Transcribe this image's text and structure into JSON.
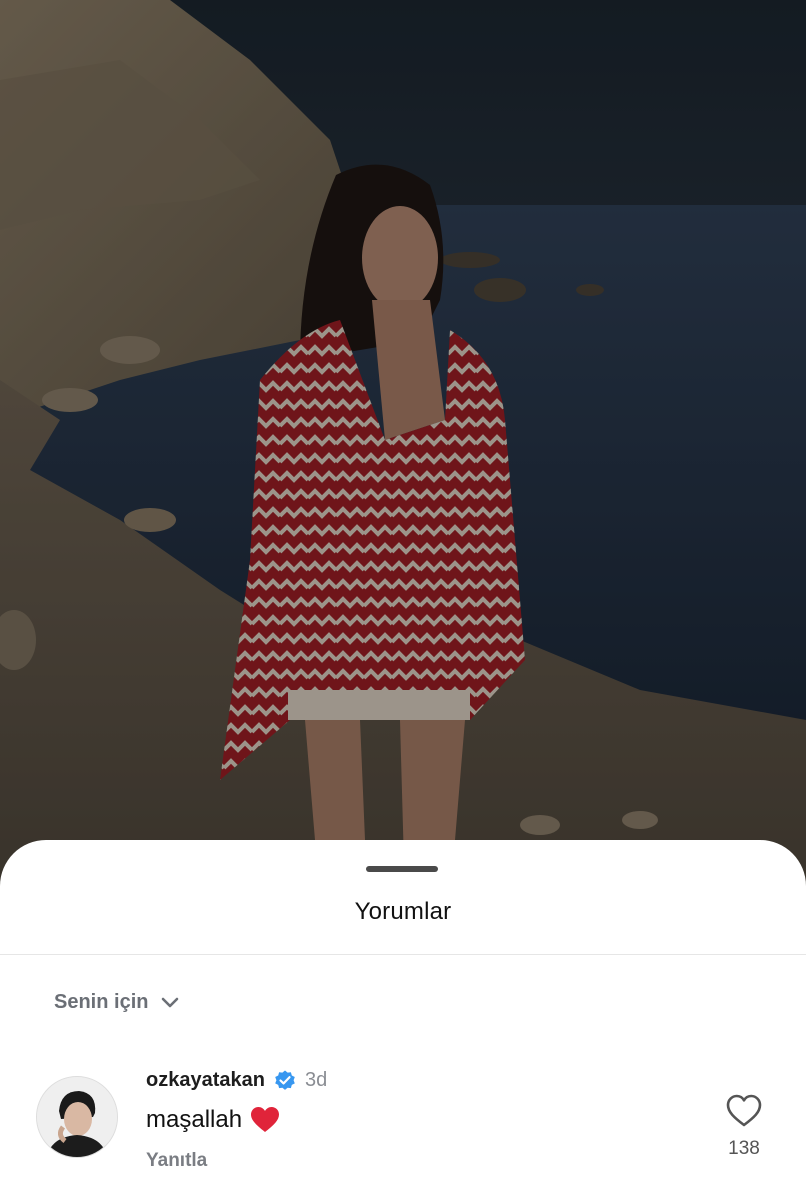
{
  "sheet": {
    "title": "Yorumlar",
    "filter_label": "Senin için"
  },
  "comment": {
    "username": "ozkayatakan",
    "time": "3d",
    "text": "maşallah",
    "reply_label": "Yanıtla",
    "like_count": "138",
    "emoji": "red-heart",
    "verified": true
  },
  "icons": {
    "filter_chevron": "chevron-down-icon",
    "verified": "verified-badge-icon",
    "like": "heart-outline-icon"
  },
  "colors": {
    "verified_blue": "#3797f0",
    "heart_red": "#e0243a",
    "sheet_bg": "#ffffff"
  }
}
